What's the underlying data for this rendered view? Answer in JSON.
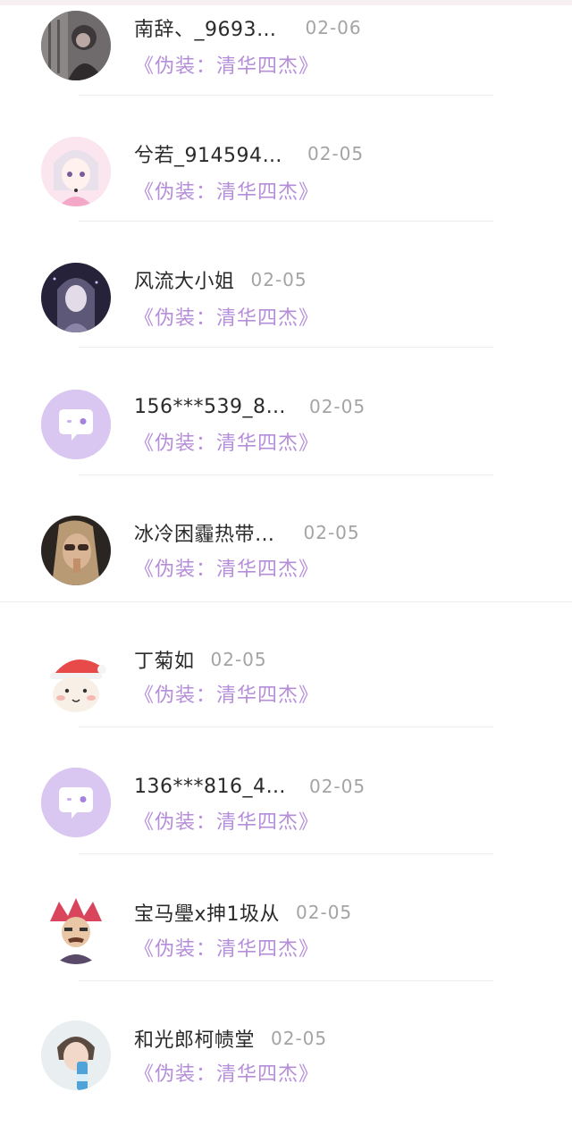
{
  "comments": [
    {
      "name": "南辞、_9693…",
      "date": "02-06",
      "book": "《伪装：清华四杰》",
      "avatar": "photo-dark-girl-avatar"
    },
    {
      "name": "兮若_914594…",
      "date": "02-05",
      "book": "《伪装：清华四杰》",
      "avatar": "anime-girl-avatar"
    },
    {
      "name": "风流大小姐",
      "date": "02-05",
      "book": "《伪装：清华四杰》",
      "avatar": "dark-fantasy-girl-avatar"
    },
    {
      "name": "156***539_8…",
      "date": "02-05",
      "book": "《伪装：清华四杰》",
      "avatar": "default-chat-bubble-avatar"
    },
    {
      "name": "冰冷困霾热带…",
      "date": "02-05",
      "book": "《伪装：清华四杰》",
      "avatar": "photo-sunglasses-avatar"
    },
    {
      "name": "丁菊如",
      "date": "02-05",
      "book": "《伪装：清华四杰》",
      "avatar": "santa-hat-cartoon-avatar"
    },
    {
      "name": "136***816_4…",
      "date": "02-05",
      "book": "《伪装：清华四杰》",
      "avatar": "default-chat-bubble-avatar"
    },
    {
      "name": "宝马璺x抻1圾从",
      "date": "02-05",
      "book": "《伪装：清华四杰》",
      "avatar": "cartoon-warrior-avatar"
    },
    {
      "name": "和光郎柯帻堂",
      "date": "02-05",
      "book": "《伪装：清华四杰》",
      "avatar": "photo-boy-bottle-avatar"
    }
  ],
  "colors": {
    "book_link": "#b58ed9",
    "default_avatar": "#d9c7f2"
  }
}
